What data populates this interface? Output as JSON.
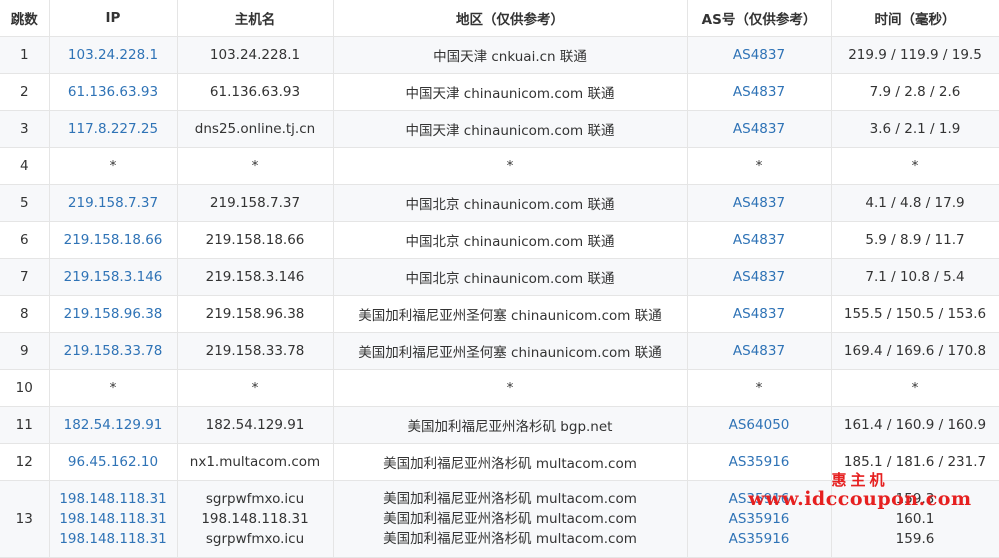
{
  "headers": {
    "hop": "跳数",
    "ip": "IP",
    "host": "主机名",
    "region": "地区（仅供参考）",
    "as": "AS号（仅供参考）",
    "time": "时间（毫秒）"
  },
  "rows": [
    {
      "hop": "1",
      "ip": [
        "103.24.228.1"
      ],
      "host": [
        "103.24.228.1"
      ],
      "region": [
        "中国天津 cnkuai.cn 联通"
      ],
      "as": [
        "AS4837"
      ],
      "time": [
        "219.9 / 119.9 / 19.5"
      ]
    },
    {
      "hop": "2",
      "ip": [
        "61.136.63.93"
      ],
      "host": [
        "61.136.63.93"
      ],
      "region": [
        "中国天津 chinaunicom.com 联通"
      ],
      "as": [
        "AS4837"
      ],
      "time": [
        "7.9 / 2.8 / 2.6"
      ]
    },
    {
      "hop": "3",
      "ip": [
        "117.8.227.25"
      ],
      "host": [
        "dns25.online.tj.cn"
      ],
      "region": [
        "中国天津 chinaunicom.com 联通"
      ],
      "as": [
        "AS4837"
      ],
      "time": [
        "3.6 / 2.1 / 1.9"
      ]
    },
    {
      "hop": "4",
      "ip": [
        "*"
      ],
      "host": [
        "*"
      ],
      "region": [
        "*"
      ],
      "as": [
        "*"
      ],
      "time": [
        "*"
      ]
    },
    {
      "hop": "5",
      "ip": [
        "219.158.7.37"
      ],
      "host": [
        "219.158.7.37"
      ],
      "region": [
        "中国北京 chinaunicom.com 联通"
      ],
      "as": [
        "AS4837"
      ],
      "time": [
        "4.1 / 4.8 / 17.9"
      ]
    },
    {
      "hop": "6",
      "ip": [
        "219.158.18.66"
      ],
      "host": [
        "219.158.18.66"
      ],
      "region": [
        "中国北京 chinaunicom.com 联通"
      ],
      "as": [
        "AS4837"
      ],
      "time": [
        "5.9 / 8.9 / 11.7"
      ]
    },
    {
      "hop": "7",
      "ip": [
        "219.158.3.146"
      ],
      "host": [
        "219.158.3.146"
      ],
      "region": [
        "中国北京 chinaunicom.com 联通"
      ],
      "as": [
        "AS4837"
      ],
      "time": [
        "7.1 / 10.8 / 5.4"
      ]
    },
    {
      "hop": "8",
      "ip": [
        "219.158.96.38"
      ],
      "host": [
        "219.158.96.38"
      ],
      "region": [
        "美国加利福尼亚州圣何塞 chinaunicom.com 联通"
      ],
      "as": [
        "AS4837"
      ],
      "time": [
        "155.5 / 150.5 / 153.6"
      ]
    },
    {
      "hop": "9",
      "ip": [
        "219.158.33.78"
      ],
      "host": [
        "219.158.33.78"
      ],
      "region": [
        "美国加利福尼亚州圣何塞 chinaunicom.com 联通"
      ],
      "as": [
        "AS4837"
      ],
      "time": [
        "169.4 / 169.6 / 170.8"
      ]
    },
    {
      "hop": "10",
      "ip": [
        "*"
      ],
      "host": [
        "*"
      ],
      "region": [
        "*"
      ],
      "as": [
        "*"
      ],
      "time": [
        "*"
      ]
    },
    {
      "hop": "11",
      "ip": [
        "182.54.129.91"
      ],
      "host": [
        "182.54.129.91"
      ],
      "region": [
        "美国加利福尼亚州洛杉矶 bgp.net"
      ],
      "as": [
        "AS64050"
      ],
      "time": [
        "161.4 / 160.9 / 160.9"
      ]
    },
    {
      "hop": "12",
      "ip": [
        "96.45.162.10"
      ],
      "host": [
        "nx1.multacom.com"
      ],
      "region": [
        "美国加利福尼亚州洛杉矶 multacom.com"
      ],
      "as": [
        "AS35916"
      ],
      "time": [
        "185.1 / 181.6 / 231.7"
      ]
    },
    {
      "hop": "13",
      "ip": [
        "198.148.118.31",
        "198.148.118.31",
        "198.148.118.31"
      ],
      "host": [
        "sgrpwfmxo.icu",
        "198.148.118.31",
        "sgrpwfmxo.icu"
      ],
      "region": [
        "美国加利福尼亚州洛杉矶 multacom.com",
        "美国加利福尼亚州洛杉矶 multacom.com",
        "美国加利福尼亚州洛杉矶 multacom.com"
      ],
      "as": [
        "AS35916",
        "AS35916",
        "AS35916"
      ],
      "time": [
        "159.3",
        "160.1",
        "159.6"
      ]
    }
  ],
  "watermark": {
    "name": "惠主机",
    "url": "www.idccoupon.com"
  },
  "colors": {
    "link": "#2f73b6",
    "stripe": "#f7f8fa",
    "border": "#e5e5e5",
    "watermark": "#e62020"
  }
}
